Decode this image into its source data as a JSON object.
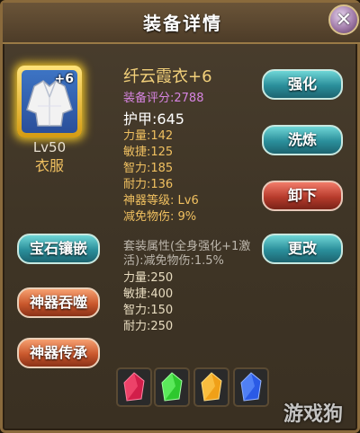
{
  "header": {
    "title": "装备详情",
    "close_symbol": "✕"
  },
  "item": {
    "plus": "+6",
    "level": "Lv50",
    "slot": "衣服",
    "name": "纤云霞衣+6",
    "score": "装备评分:2788",
    "armor": "护甲:645",
    "stats": [
      "力量:142",
      "敏捷:125",
      "智力:185",
      "耐力:136",
      "神器等级: Lv6",
      "减免物伤: 9%"
    ],
    "set_desc": "套装属性(全身强化+1激活):减免物伤:1.5%",
    "set_stats": [
      "力量:250",
      "敏捷:400",
      "智力:150",
      "耐力:250"
    ]
  },
  "buttons": {
    "enhance": "强化",
    "refine": "洗炼",
    "unequip": "卸下",
    "change": "更改",
    "gem_inlay": "宝石镶嵌",
    "devour": "神器吞噬",
    "inherit": "神器传承"
  },
  "gems": [
    {
      "name": "red-gem",
      "color": "#d21e4a"
    },
    {
      "name": "green-gem",
      "color": "#2ec82e"
    },
    {
      "name": "orange-gem",
      "color": "#f0a018"
    },
    {
      "name": "blue-gem",
      "color": "#2a5ae6"
    }
  ],
  "watermark": "游戏狗"
}
